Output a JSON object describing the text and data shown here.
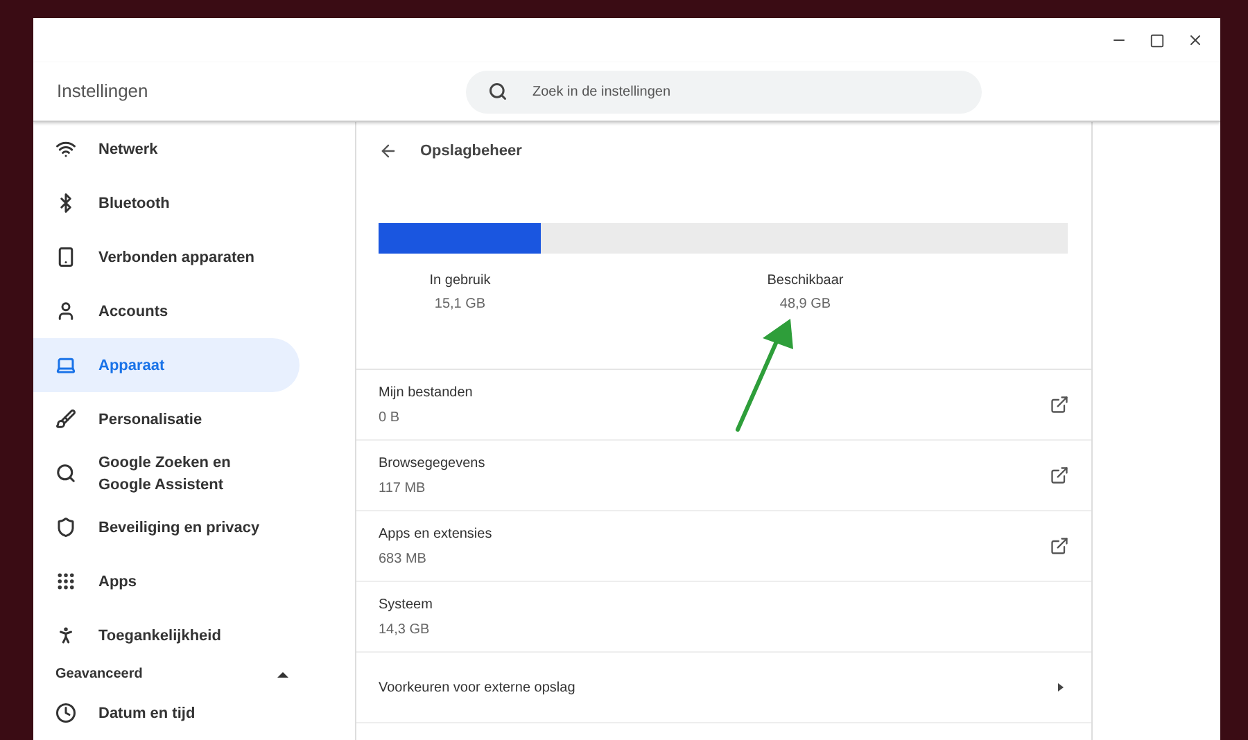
{
  "window": {
    "title": "Instellingen"
  },
  "search": {
    "placeholder": "Zoek in de instellingen"
  },
  "sidebar": {
    "items": [
      {
        "label": "Netwerk",
        "selected": false
      },
      {
        "label": "Bluetooth",
        "selected": false
      },
      {
        "label": "Verbonden apparaten",
        "selected": false
      },
      {
        "label": "Accounts",
        "selected": false
      },
      {
        "label": "Apparaat",
        "selected": true
      },
      {
        "label": "Personalisatie",
        "selected": false
      },
      {
        "label": "Google Zoeken en Google Assistent",
        "selected": false
      },
      {
        "label": "Beveiliging en privacy",
        "selected": false
      },
      {
        "label": "Apps",
        "selected": false
      },
      {
        "label": "Toegankelijkheid",
        "selected": false
      }
    ],
    "advanced": {
      "label": "Geavanceerd",
      "expanded": true,
      "items": [
        {
          "label": "Datum en tijd",
          "selected": false
        }
      ]
    }
  },
  "page": {
    "title": "Opslagbeheer",
    "storage": {
      "level": 0.236,
      "used_label": "In gebruik",
      "used_value": "15,1 GB",
      "free_label": "Beschikbaar",
      "free_value": "48,9 GB"
    },
    "rows": [
      {
        "kind": "external",
        "title": "Mijn bestanden",
        "value": "0 B"
      },
      {
        "kind": "external",
        "title": "Browsegegevens",
        "value": "117 MB"
      },
      {
        "kind": "external",
        "title": "Apps en extensies",
        "value": "683 MB"
      },
      {
        "kind": "plain",
        "title": "Systeem",
        "value": "14,3 GB"
      },
      {
        "kind": "submenu",
        "title": "Voorkeuren voor externe opslag"
      }
    ]
  }
}
